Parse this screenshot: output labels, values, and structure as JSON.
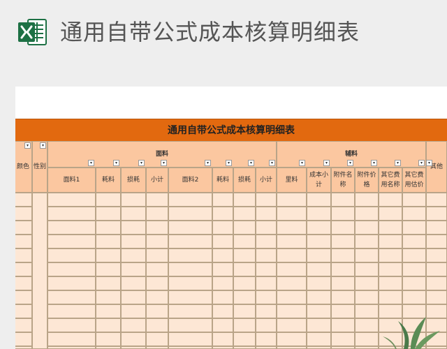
{
  "header": {
    "app_icon": "excel-icon",
    "title": "通用自带公式成本核算明细表"
  },
  "sheet": {
    "title": "通用自带公式成本核算明细表",
    "colors": {
      "banner": "#e2690f",
      "header_fill": "#fbc7a0",
      "body_fill": "#fde7d5",
      "grid": "#b9a488"
    },
    "left_columns": [
      "颜色",
      "性别"
    ],
    "groups": [
      {
        "label": "面料",
        "columns": [
          "面料1",
          "耗料",
          "损耗",
          "小计",
          "面料2",
          "耗料",
          "损耗",
          "小计"
        ]
      },
      {
        "label": "辅料",
        "columns": [
          "里料",
          "成本小计",
          "附件名称",
          "附件价格",
          "其它费用名称",
          "其它费用估价"
        ]
      }
    ],
    "right_edge_column": "其他",
    "dropdown_icon": "filter-dropdown-icon"
  },
  "decoration": {
    "plant": "plant-decoration-icon"
  }
}
